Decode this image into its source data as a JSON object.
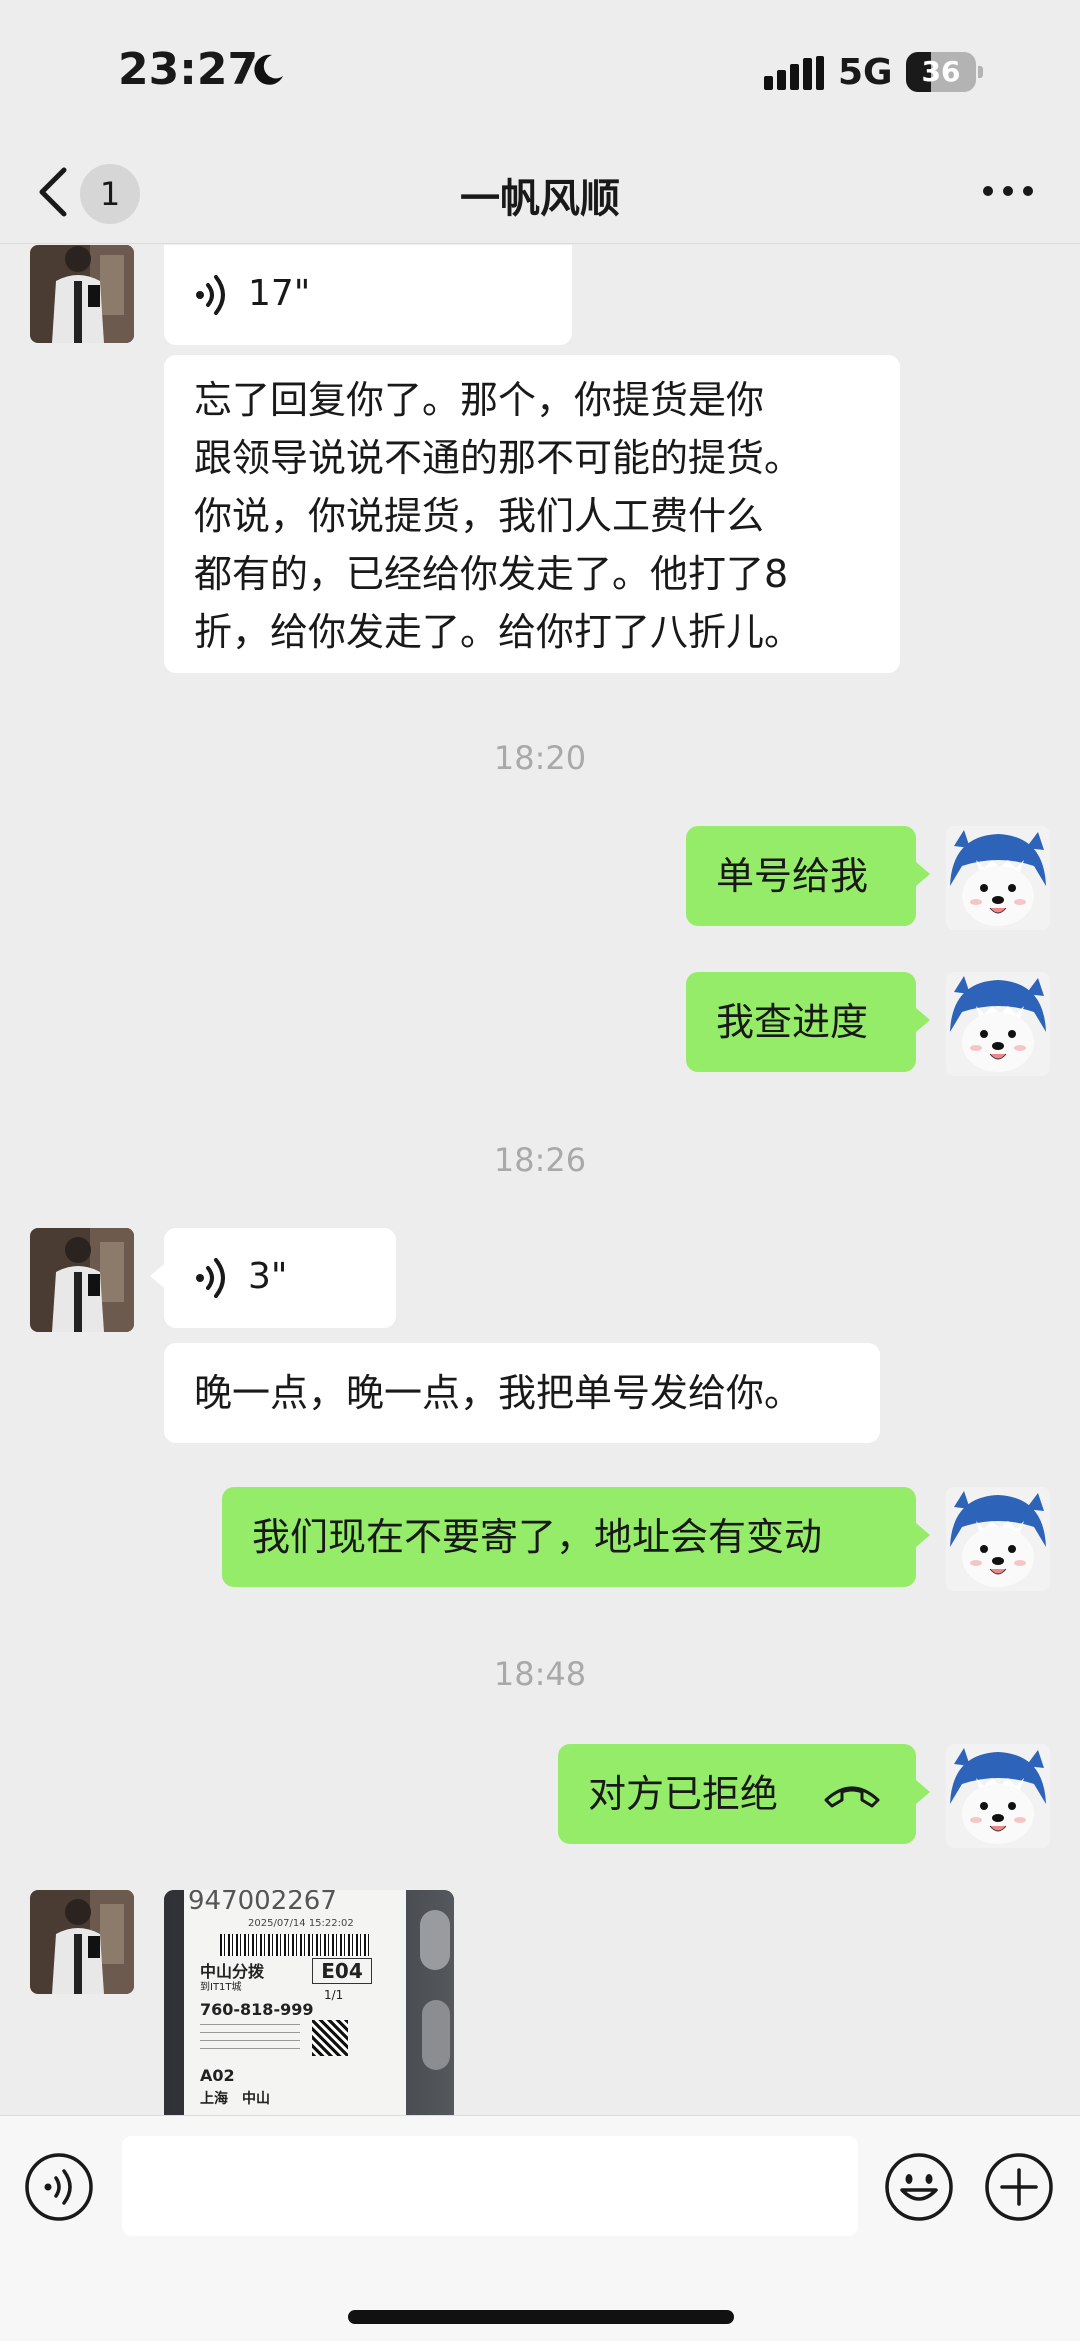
{
  "status_bar": {
    "time": "23:27",
    "network": "5G",
    "battery": "36",
    "battery_level": 0.36
  },
  "header": {
    "back_count": "1",
    "title": "一帆风顺"
  },
  "messages": {
    "voice1": {
      "duration": "17\""
    },
    "text1": {
      "lines": [
        "忘了回复你了。那个，你提货是你",
        "跟领导说说不通的那不可能的提货。",
        "你说，你说提货，我们人工费什么",
        "都有的，已经给你发走了。他打了8",
        "折，给你发走了。给你打了八折儿。"
      ]
    },
    "time1": "18:20",
    "out1": "单号给我",
    "out2": "我查进度",
    "time2": "18:26",
    "voice2": {
      "duration": "3\""
    },
    "text2": "晚一点，晚一点，我把单号发给你。",
    "out3": "我们现在不要寄了，地址会有变动",
    "time3": "18:48",
    "call": "对方已拒绝",
    "photo": {
      "code": "947002267",
      "date": "2025/07/14 15:22:02",
      "branch": "中山分拨",
      "branch_sub": "到IT1T城",
      "slot": "E04",
      "count": "1/1",
      "phone": "760-818-999",
      "zone": "A02",
      "city1": "上海",
      "city2": "中山"
    }
  },
  "colors": {
    "outgoing_bubble": "#95ec69",
    "incoming_bubble": "#ffffff",
    "background": "#ededed",
    "timestamp": "#a9a9a9"
  },
  "icons": [
    "moon-icon",
    "signal-icon",
    "back-chevron-icon",
    "more-icon",
    "voice-wave-icon",
    "hangup-icon",
    "voice-input-icon",
    "emoji-icon",
    "plus-icon"
  ]
}
